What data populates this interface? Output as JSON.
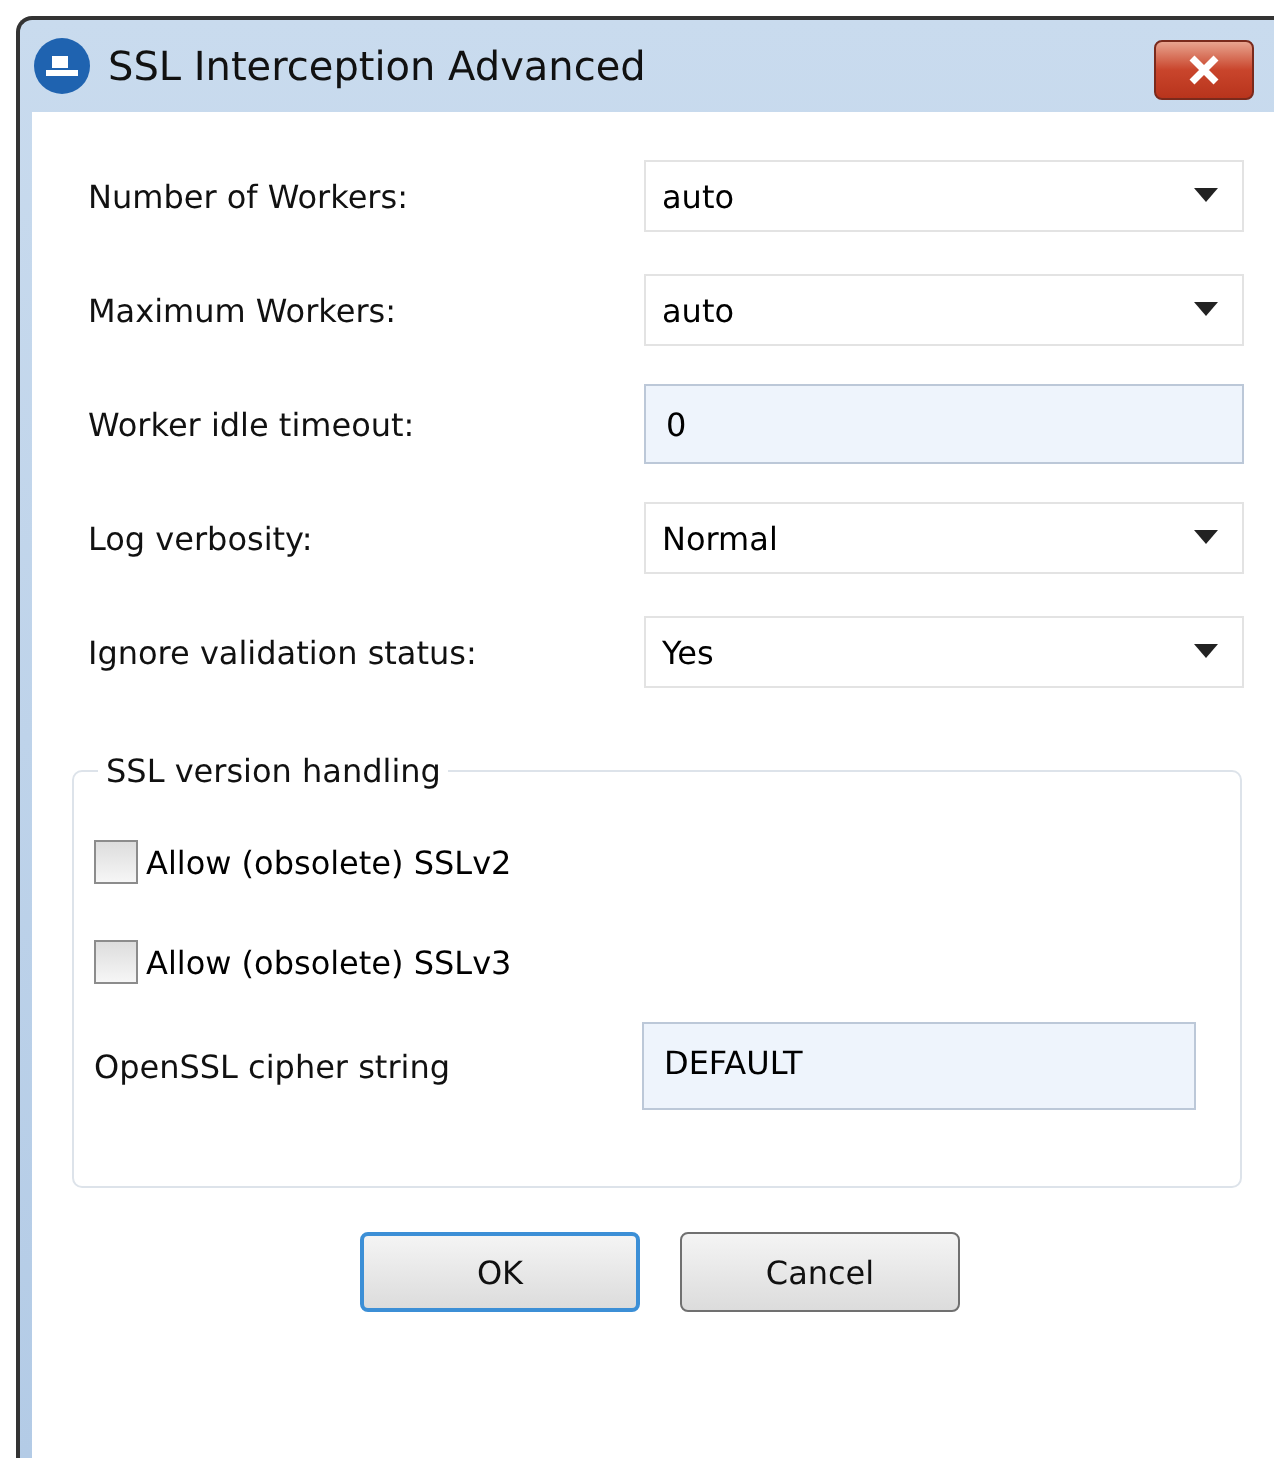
{
  "window": {
    "title": "SSL Interception Advanced"
  },
  "fields": [
    {
      "label": "Number of Workers:",
      "kind": "select",
      "value": "auto"
    },
    {
      "label": "Maximum Workers:",
      "kind": "select",
      "value": "auto"
    },
    {
      "label": "Worker idle timeout:",
      "kind": "text",
      "value": "0"
    },
    {
      "label": "Log verbosity:",
      "kind": "select",
      "value": "Normal"
    },
    {
      "label": "Ignore validation status:",
      "kind": "select",
      "value": "Yes"
    }
  ],
  "group": {
    "title": "SSL version handling",
    "checkboxes": [
      {
        "label": "Allow (obsolete) SSLv2",
        "checked": false
      },
      {
        "label": "Allow (obsolete) SSLv3",
        "checked": false
      }
    ],
    "cipher": {
      "label": "OpenSSL cipher string",
      "value": "DEFAULT"
    }
  },
  "buttons": [
    {
      "label": "OK",
      "selected": true
    },
    {
      "label": "Cancel",
      "selected": false
    }
  ]
}
